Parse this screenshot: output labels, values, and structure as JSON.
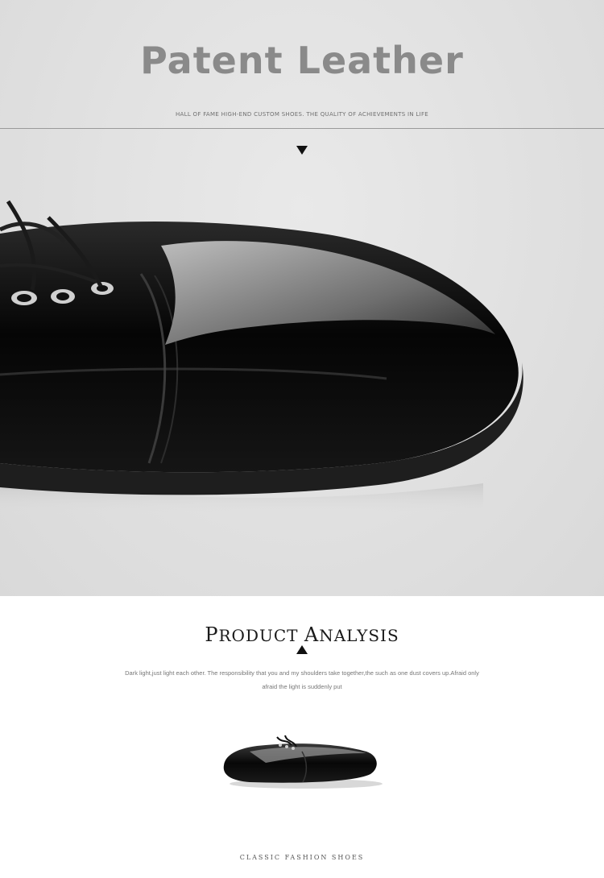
{
  "hero": {
    "title": "Patent Leather",
    "subtitle": "HALL OF FAME HIGH-END CUSTOM SHOES. THE QUALITY OF ACHIEVEMENTS IN LIFE",
    "background_color": "#e3e3e3"
  },
  "analysis": {
    "title_first_cap": "P",
    "title_first_rest": "RODUCT ",
    "title_second_cap": "A",
    "title_second_rest": "NALYSIS",
    "description_line1": "Dark light,just light each other. The responsibility that you and my shoulders take together,the such as one dust covers up.Afraid only",
    "description_line2": "afraid the light is suddenly put"
  },
  "footer": {
    "caption": "CLASSIC FASHION SHOES"
  },
  "icons": {
    "down_arrow": "triangle-down-icon",
    "up_arrow": "triangle-up-icon"
  },
  "colors": {
    "title_gray": "#8a8a8a",
    "leather_black": "#0a0a0a"
  }
}
